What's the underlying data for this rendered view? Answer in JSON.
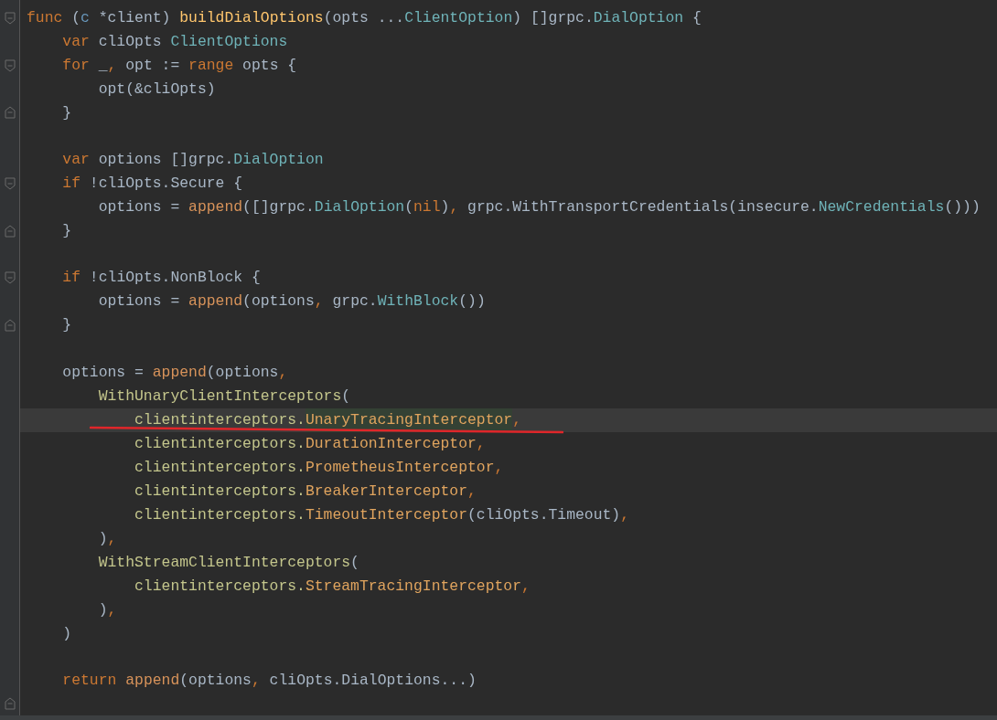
{
  "editor": {
    "lines": [
      {
        "current": false,
        "underlined": false,
        "kind": "fold-open",
        "tokens": [
          {
            "kind": "kw",
            "t": "func"
          },
          {
            "kind": "plain",
            "t": " ("
          },
          {
            "kind": "param",
            "t": "c"
          },
          {
            "kind": "plain",
            "t": " *client) "
          },
          {
            "kind": "fn",
            "t": "buildDialOptions"
          },
          {
            "kind": "plain",
            "t": "(opts ..."
          },
          {
            "kind": "type",
            "t": "ClientOption"
          },
          {
            "kind": "plain",
            "t": ") []grpc."
          },
          {
            "kind": "type",
            "t": "DialOption"
          },
          {
            "kind": "plain",
            "t": " {"
          }
        ]
      },
      {
        "current": false,
        "underlined": false,
        "kind": "plain",
        "tokens": [
          {
            "kind": "kw",
            "t": "    var"
          },
          {
            "kind": "plain",
            "t": " cliOpts "
          },
          {
            "kind": "type",
            "t": "ClientOptions"
          }
        ]
      },
      {
        "current": false,
        "underlined": false,
        "kind": "fold-open",
        "tokens": [
          {
            "kind": "kw",
            "t": "    for"
          },
          {
            "kind": "plain",
            "t": " _"
          },
          {
            "kind": "kw",
            "t": ","
          },
          {
            "kind": "plain",
            "t": " opt := "
          },
          {
            "kind": "kw",
            "t": "range"
          },
          {
            "kind": "plain",
            "t": " opts {"
          }
        ]
      },
      {
        "current": false,
        "underlined": false,
        "kind": "plain",
        "tokens": [
          {
            "kind": "plain",
            "t": "        opt(&cliOpts)"
          }
        ]
      },
      {
        "current": false,
        "underlined": false,
        "kind": "fold-close",
        "tokens": [
          {
            "kind": "plain",
            "t": "    }"
          }
        ]
      },
      {
        "current": false,
        "underlined": false,
        "kind": "plain"
      },
      {
        "current": false,
        "underlined": false,
        "kind": "plain",
        "tokens": [
          {
            "kind": "kw",
            "t": "    var"
          },
          {
            "kind": "plain",
            "t": " options []grpc."
          },
          {
            "kind": "type",
            "t": "DialOption"
          }
        ]
      },
      {
        "current": false,
        "underlined": false,
        "kind": "fold-open",
        "tokens": [
          {
            "kind": "kw",
            "t": "    if"
          },
          {
            "kind": "plain",
            "t": " !cliOpts.Secure {"
          }
        ]
      },
      {
        "current": false,
        "underlined": false,
        "kind": "plain",
        "tokens": [
          {
            "kind": "plain",
            "t": "        options = "
          },
          {
            "kind": "call",
            "t": "append"
          },
          {
            "kind": "plain",
            "t": "([]grpc."
          },
          {
            "kind": "type",
            "t": "DialOption"
          },
          {
            "kind": "plain",
            "t": "("
          },
          {
            "kind": "kw",
            "t": "nil"
          },
          {
            "kind": "plain",
            "t": ")"
          },
          {
            "kind": "kw",
            "t": ","
          },
          {
            "kind": "plain",
            "t": " grpc.WithTransportCredentials(insecure."
          },
          {
            "kind": "type",
            "t": "NewCredentials"
          },
          {
            "kind": "plain",
            "t": "()))"
          }
        ]
      },
      {
        "current": false,
        "underlined": false,
        "kind": "fold-close",
        "tokens": [
          {
            "kind": "plain",
            "t": "    }"
          }
        ]
      },
      {
        "current": false,
        "underlined": false,
        "kind": "plain"
      },
      {
        "current": false,
        "underlined": false,
        "kind": "fold-open",
        "tokens": [
          {
            "kind": "kw",
            "t": "    if"
          },
          {
            "kind": "plain",
            "t": " !cliOpts.NonBlock {"
          }
        ]
      },
      {
        "current": false,
        "underlined": false,
        "kind": "plain",
        "tokens": [
          {
            "kind": "plain",
            "t": "        options = "
          },
          {
            "kind": "call",
            "t": "append"
          },
          {
            "kind": "plain",
            "t": "(options"
          },
          {
            "kind": "kw",
            "t": ","
          },
          {
            "kind": "plain",
            "t": " grpc."
          },
          {
            "kind": "type",
            "t": "WithBlock"
          },
          {
            "kind": "plain",
            "t": "())"
          }
        ]
      },
      {
        "current": false,
        "underlined": false,
        "kind": "fold-close",
        "tokens": [
          {
            "kind": "plain",
            "t": "    }"
          }
        ]
      },
      {
        "current": false,
        "underlined": false,
        "kind": "plain"
      },
      {
        "current": false,
        "underlined": false,
        "kind": "plain",
        "tokens": [
          {
            "kind": "plain",
            "t": "    options = "
          },
          {
            "kind": "call",
            "t": "append"
          },
          {
            "kind": "plain",
            "t": "(options"
          },
          {
            "kind": "kw",
            "t": ","
          }
        ]
      },
      {
        "current": false,
        "underlined": false,
        "kind": "plain",
        "tokens": [
          {
            "kind": "pkg",
            "t": "        WithUnaryClientInterceptors"
          },
          {
            "kind": "plain",
            "t": "("
          }
        ]
      },
      {
        "current": true,
        "underlined": true,
        "kind": "plain",
        "tokens": [
          {
            "kind": "pkg",
            "t": "            clientinterceptors."
          },
          {
            "kind": "hl",
            "t": "UnaryTracingInterceptor"
          },
          {
            "kind": "kw",
            "t": ","
          }
        ]
      },
      {
        "current": false,
        "underlined": false,
        "kind": "plain",
        "tokens": [
          {
            "kind": "pkg",
            "t": "            clientinterceptors."
          },
          {
            "kind": "method",
            "t": "DurationInterceptor"
          },
          {
            "kind": "kw",
            "t": ","
          }
        ]
      },
      {
        "current": false,
        "underlined": false,
        "kind": "plain",
        "tokens": [
          {
            "kind": "pkg",
            "t": "            clientinterceptors."
          },
          {
            "kind": "method",
            "t": "PrometheusInterceptor"
          },
          {
            "kind": "kw",
            "t": ","
          }
        ]
      },
      {
        "current": false,
        "underlined": false,
        "kind": "plain",
        "tokens": [
          {
            "kind": "pkg",
            "t": "            clientinterceptors."
          },
          {
            "kind": "method",
            "t": "BreakerInterceptor"
          },
          {
            "kind": "kw",
            "t": ","
          }
        ]
      },
      {
        "current": false,
        "underlined": false,
        "kind": "plain",
        "tokens": [
          {
            "kind": "pkg",
            "t": "            clientinterceptors."
          },
          {
            "kind": "method",
            "t": "TimeoutInterceptor"
          },
          {
            "kind": "plain",
            "t": "(cliOpts.Timeout)"
          },
          {
            "kind": "kw",
            "t": ","
          }
        ]
      },
      {
        "current": false,
        "underlined": false,
        "kind": "plain",
        "tokens": [
          {
            "kind": "plain",
            "t": "        )"
          },
          {
            "kind": "kw",
            "t": ","
          }
        ]
      },
      {
        "current": false,
        "underlined": false,
        "kind": "plain",
        "tokens": [
          {
            "kind": "pkg",
            "t": "        WithStreamClientInterceptors"
          },
          {
            "kind": "plain",
            "t": "("
          }
        ]
      },
      {
        "current": false,
        "underlined": false,
        "kind": "plain",
        "tokens": [
          {
            "kind": "pkg",
            "t": "            clientinterceptors."
          },
          {
            "kind": "method",
            "t": "StreamTracingInterceptor"
          },
          {
            "kind": "kw",
            "t": ","
          }
        ]
      },
      {
        "current": false,
        "underlined": false,
        "kind": "plain",
        "tokens": [
          {
            "kind": "plain",
            "t": "        )"
          },
          {
            "kind": "kw",
            "t": ","
          }
        ]
      },
      {
        "current": false,
        "underlined": false,
        "kind": "plain",
        "tokens": [
          {
            "kind": "plain",
            "t": "    )"
          }
        ]
      },
      {
        "current": false,
        "underlined": false,
        "kind": "plain"
      },
      {
        "current": false,
        "underlined": false,
        "kind": "plain",
        "tokens": [
          {
            "kind": "kw",
            "t": "    return"
          },
          {
            "kind": "call",
            "t": " append"
          },
          {
            "kind": "plain",
            "t": "(options"
          },
          {
            "kind": "kw",
            "t": ","
          },
          {
            "kind": "plain",
            "t": " cliOpts.DialOptions...)"
          }
        ]
      },
      {
        "current": false,
        "underlined": false,
        "kind": "fold-close"
      }
    ]
  }
}
